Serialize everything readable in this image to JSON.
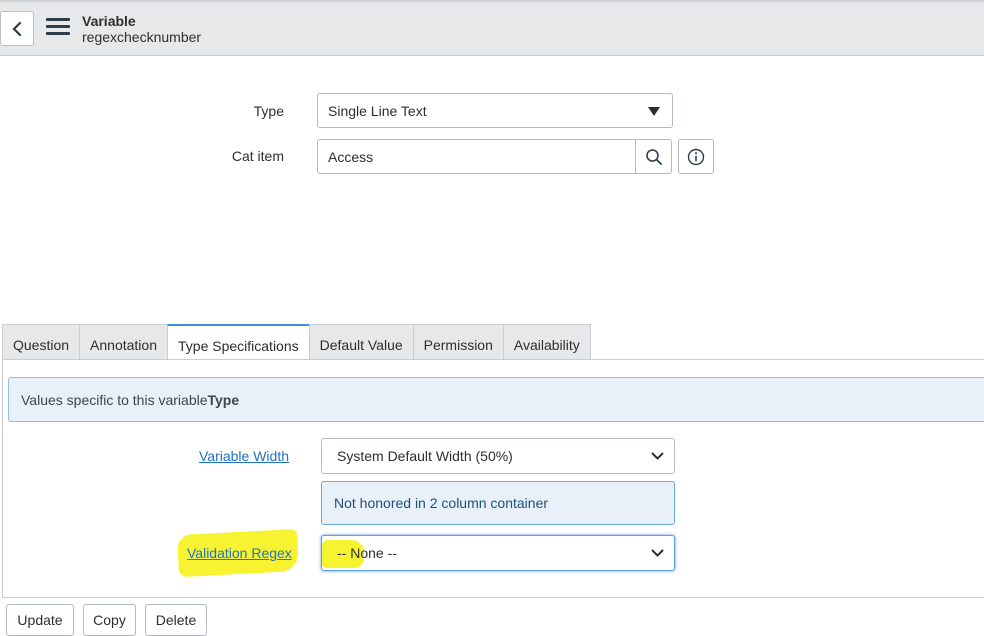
{
  "header": {
    "title": "Variable",
    "subtitle": "regexchecknumber"
  },
  "form": {
    "type_label": "Type",
    "type_value": "Single Line Text",
    "cat_item_label": "Cat item",
    "cat_item_value": "Access"
  },
  "tabs": [
    {
      "label": "Question"
    },
    {
      "label": "Annotation"
    },
    {
      "label": "Type Specifications",
      "active": true
    },
    {
      "label": "Default Value"
    },
    {
      "label": "Permission"
    },
    {
      "label": "Availability"
    }
  ],
  "type_specs": {
    "banner_text": "Values specific to this variable",
    "banner_bold": "Type",
    "variable_width_label": "Variable Width",
    "variable_width_value": "System Default Width (50%)",
    "note": "Not honored in 2 column container",
    "validation_regex_label": "Validation Regex",
    "validation_regex_value": "-- None --"
  },
  "footer": {
    "update_label": "Update",
    "copy_label": "Copy",
    "delete_label": "Delete"
  },
  "colors": {
    "header_bg": "#e6e8ea",
    "link": "#1f73c7",
    "highlight": "#f7f21a",
    "active_tab_accent": "#3d8fd6"
  }
}
